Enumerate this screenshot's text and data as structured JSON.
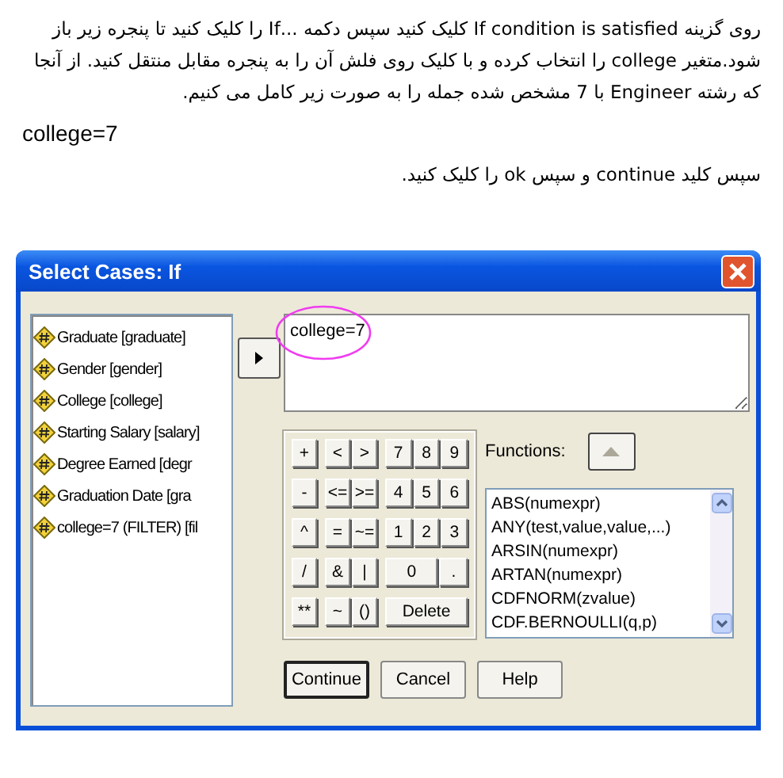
{
  "paragraphs": [
    {
      "kind": "rtl",
      "text": "روی گزینه If condition is satisfied کلیک کنید سپس دکمه ...If را کلیک کنید تا پنجره زیر باز شود.متغیر college را انتخاب کرده و با کلیک روی فلش آن را به پنجره مقابل منتقل کنید. از آنجا که رشته Engineer با 7 مشخص شده جمله را به صورت زیر کامل می کنیم."
    },
    {
      "kind": "ltr",
      "text": "college=7"
    },
    {
      "kind": "rtl",
      "text": "سپس کلید continue و سپس ok را کلیک کنید."
    }
  ],
  "dialog": {
    "title": "Select Cases: If",
    "variables": [
      "Graduate [graduate]",
      "Gender [gender]",
      "College [college]",
      "Starting Salary [salary]",
      "Degree Earned [degr",
      "Graduation Date [gra",
      "college=7 (FILTER) [fil"
    ],
    "expression": "college=7",
    "keypad": [
      [
        [
          {
            "label": "+",
            "kind": "normal"
          }
        ],
        [
          {
            "label": "<",
            "kind": "normal"
          },
          {
            "label": ">",
            "kind": "normal"
          }
        ],
        [
          {
            "label": "7",
            "kind": "normal"
          },
          {
            "label": "8",
            "kind": "normal"
          },
          {
            "label": "9",
            "kind": "normal"
          }
        ]
      ],
      [
        [
          {
            "label": "-",
            "kind": "normal"
          }
        ],
        [
          {
            "label": "<=",
            "kind": "normal"
          },
          {
            "label": ">=",
            "kind": "normal"
          }
        ],
        [
          {
            "label": "4",
            "kind": "normal"
          },
          {
            "label": "5",
            "kind": "normal"
          },
          {
            "label": "6",
            "kind": "normal"
          }
        ]
      ],
      [
        [
          {
            "label": "^",
            "kind": "normal"
          }
        ],
        [
          {
            "label": "=",
            "kind": "normal"
          },
          {
            "label": "~=",
            "kind": "normal"
          }
        ],
        [
          {
            "label": "1",
            "kind": "normal"
          },
          {
            "label": "2",
            "kind": "normal"
          },
          {
            "label": "3",
            "kind": "normal"
          }
        ]
      ],
      [
        [
          {
            "label": "/",
            "kind": "normal"
          }
        ],
        [
          {
            "label": "&",
            "kind": "normal"
          },
          {
            "label": "|",
            "kind": "normal"
          }
        ],
        [
          {
            "label": "0",
            "kind": "wide"
          },
          {
            "label": ".",
            "kind": "normal"
          }
        ]
      ],
      [
        [
          {
            "label": "**",
            "kind": "normal"
          }
        ],
        [
          {
            "label": "~",
            "kind": "normal"
          },
          {
            "label": "()",
            "kind": "normal"
          }
        ],
        [
          {
            "label": "Delete",
            "kind": "wide"
          }
        ]
      ]
    ],
    "functions_label": "Functions:",
    "functions": [
      "ABS(numexpr)",
      "ANY(test,value,value,...)",
      "ARSIN(numexpr)",
      "ARTAN(numexpr)",
      "CDFNORM(zvalue)",
      "CDF.BERNOULLI(q,p)"
    ],
    "buttons": [
      {
        "label": "Continue",
        "kind": "default"
      },
      {
        "label": "Cancel",
        "kind": "normal"
      },
      {
        "label": "Help",
        "kind": "normal"
      }
    ]
  }
}
